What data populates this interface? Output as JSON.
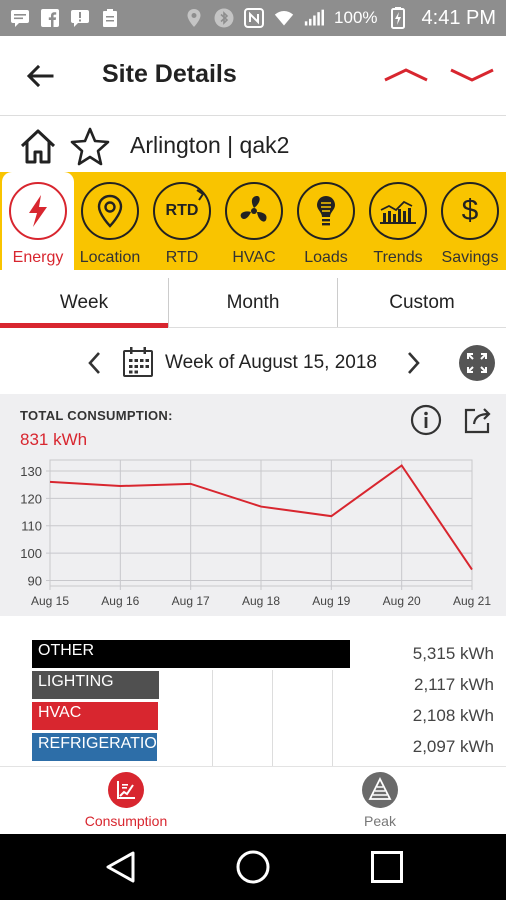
{
  "status_bar": {
    "battery_pct": "100%",
    "time": "4:41 PM"
  },
  "app_bar": {
    "title": "Site Details",
    "back_icon": "arrow-left-icon",
    "prev_icon": "chevron-up-icon",
    "next_icon": "chevron-down-icon"
  },
  "site": {
    "name": "Arlington | qak2"
  },
  "tabs": [
    {
      "label": "Energy",
      "icon": "lightning-icon",
      "active": true
    },
    {
      "label": "Location",
      "icon": "map-pin-icon"
    },
    {
      "label": "RTD",
      "icon": "rtd-icon",
      "text": "RTD"
    },
    {
      "label": "HVAC",
      "icon": "fan-icon"
    },
    {
      "label": "Loads",
      "icon": "bulb-icon"
    },
    {
      "label": "Trends",
      "icon": "trends-icon"
    },
    {
      "label": "Savings",
      "icon": "dollar-icon",
      "text": "$"
    }
  ],
  "periods": [
    {
      "label": "Week",
      "active": true
    },
    {
      "label": "Month"
    },
    {
      "label": "Custom"
    }
  ],
  "week_label": "Week of August 15, 2018",
  "total": {
    "label": "TOTAL CONSUMPTION:",
    "value": "831 kWh"
  },
  "chart_data": {
    "type": "line",
    "x": [
      "Aug 15",
      "Aug 16",
      "Aug 17",
      "Aug 18",
      "Aug 19",
      "Aug 20",
      "Aug 21"
    ],
    "series": [
      {
        "values": [
          126,
          124.5,
          125.3,
          117,
          113.5,
          132,
          94
        ]
      }
    ],
    "y_ticks": [
      90,
      100,
      110,
      120,
      130
    ],
    "ylim": [
      88,
      134
    ],
    "grid": true,
    "colors": {
      "line": "#d8262f",
      "grid": "#c8c8cc"
    }
  },
  "breakdown": [
    {
      "label": "OTHER",
      "value": "5,315 kWh",
      "kwh": 5315,
      "color": "#000000"
    },
    {
      "label": "LIGHTING",
      "value": "2,117 kWh",
      "kwh": 2117,
      "color": "#505050"
    },
    {
      "label": "HVAC",
      "value": "2,108 kWh",
      "kwh": 2108,
      "color": "#d8262f"
    },
    {
      "label": "REFRIGERATION",
      "value": "2,097 kWh",
      "kwh": 2097,
      "color": "#2d6ea8"
    }
  ],
  "bottom_nav": [
    {
      "label": "Consumption",
      "active": true
    },
    {
      "label": "Peak"
    }
  ],
  "colors": {
    "accent": "#d8262f",
    "tab_bg": "#f9c400",
    "status_bg": "#8e8e8e"
  }
}
